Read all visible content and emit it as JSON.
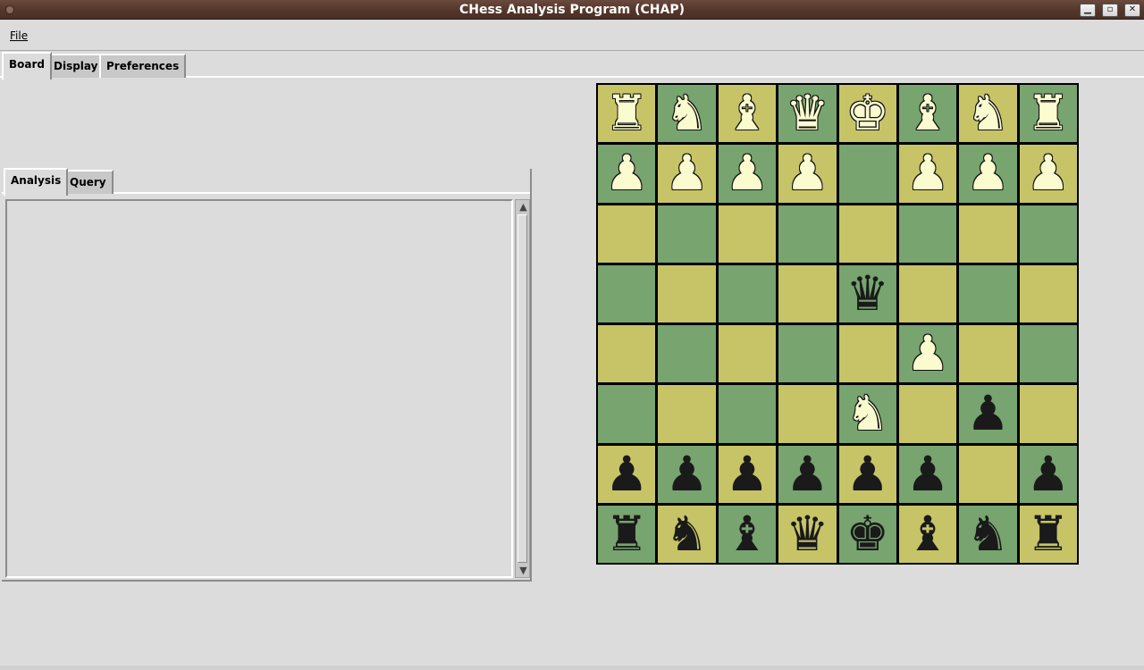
{
  "window": {
    "title": "CHess Analysis Program (CHAP)",
    "min_label": "▁",
    "max_label": "▫",
    "close_label": "✕"
  },
  "menubar": {
    "file_label": "File"
  },
  "main_tabs": {
    "board": "Board",
    "display": "Display",
    "preferences": "Preferences",
    "active": "Board"
  },
  "inner_tabs": {
    "analysis": "Analysis",
    "query": "Query",
    "active": "Analysis"
  },
  "analysis_text": "",
  "scroll": {
    "up_arrow": "▲",
    "down_arrow": "▼"
  },
  "colors": {
    "light_square": "#c7c467",
    "dark_square": "#77a46f",
    "white_piece": "#fbfbd0",
    "black_piece": "#1a1a1a"
  },
  "board": {
    "ranks": [
      [
        "wR",
        "wN",
        "wB",
        "wQ",
        "wK",
        "wB",
        "wN",
        "wR"
      ],
      [
        "wP",
        "wP",
        "wP",
        "wP",
        "",
        "wP",
        "wP",
        "wP"
      ],
      [
        "",
        "",
        "",
        "",
        "",
        "",
        "",
        ""
      ],
      [
        "",
        "",
        "",
        "",
        "bQ",
        "",
        "",
        ""
      ],
      [
        "",
        "",
        "",
        "",
        "",
        "wP",
        "",
        ""
      ],
      [
        "",
        "",
        "",
        "",
        "wN",
        "",
        "bP",
        ""
      ],
      [
        "bP",
        "bP",
        "bP",
        "bP",
        "bP",
        "bP",
        "",
        "bP"
      ],
      [
        "bR",
        "bN",
        "bB",
        "bQ",
        "bK",
        "bB",
        "bN",
        "bR"
      ]
    ],
    "top_left_is_light": true
  }
}
